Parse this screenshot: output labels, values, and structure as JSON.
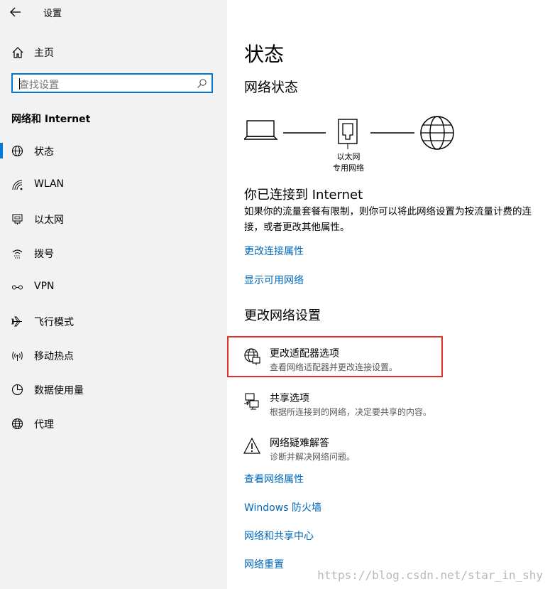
{
  "window": {
    "title": "设置"
  },
  "sidebar": {
    "home_label": "主页",
    "search_placeholder": "查找设置",
    "section_title": "网络和 Internet",
    "items": [
      {
        "label": "状态",
        "icon": "globe-status-icon"
      },
      {
        "label": "WLAN",
        "icon": "wifi-icon"
      },
      {
        "label": "以太网",
        "icon": "ethernet-icon"
      },
      {
        "label": "拨号",
        "icon": "dialup-icon"
      },
      {
        "label": "VPN",
        "icon": "vpn-icon"
      },
      {
        "label": "飞行模式",
        "icon": "airplane-icon"
      },
      {
        "label": "移动热点",
        "icon": "hotspot-icon"
      },
      {
        "label": "数据使用量",
        "icon": "data-usage-icon"
      },
      {
        "label": "代理",
        "icon": "globe-icon"
      }
    ],
    "active_index": 0
  },
  "main": {
    "title": "状态",
    "network_status_title": "网络状态",
    "diagram": {
      "adapter_name": "以太网",
      "network_type": "专用网络"
    },
    "connected_title": "你已连接到 Internet",
    "connected_desc": "如果你的流量套餐有限制，则你可以将此网络设置为按流量计费的连接，或者更改其他属性。",
    "links_top": [
      "更改连接属性",
      "显示可用网络"
    ],
    "change_settings_title": "更改网络设置",
    "options": [
      {
        "title": "更改适配器选项",
        "desc": "查看网络适配器并更改连接设置。",
        "icon": "adapter-globe-icon"
      },
      {
        "title": "共享选项",
        "desc": "根据所连接到的网络，决定要共享的内容。",
        "icon": "sharing-icon"
      },
      {
        "title": "网络疑难解答",
        "desc": "诊断并解决网络问题。",
        "icon": "warning-icon"
      }
    ],
    "links_bottom": [
      "查看网络属性",
      "Windows 防火墙",
      "网络和共享中心",
      "网络重置"
    ]
  },
  "watermark": "https://blog.csdn.net/star_in_shy",
  "colors": {
    "accent": "#0078d7",
    "link": "#0067b8",
    "highlight": "#e0302d",
    "sidebar_bg": "#f2f2f2"
  }
}
